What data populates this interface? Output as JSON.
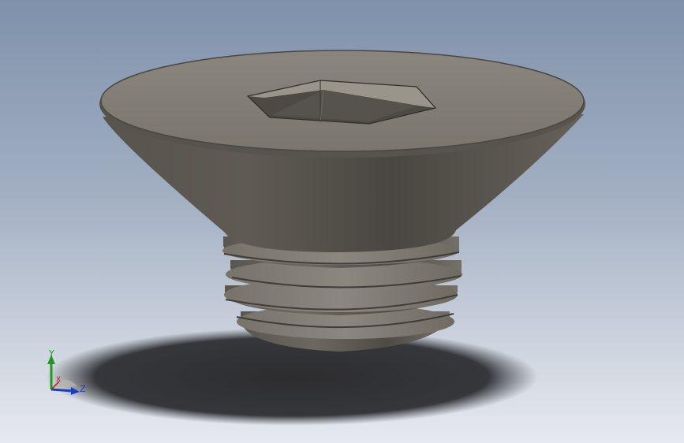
{
  "viewport": {
    "background_top": "#7f91ab",
    "background_bottom": "#e6e9ef"
  },
  "model": {
    "part_type": "countersunk socket head screw",
    "body_color": "#6e6a63",
    "shadow_color": "#3a3a3c"
  },
  "triad": {
    "y_label": "Y",
    "z_label": "Z",
    "x_label": "X",
    "y_color": "#1f9a1f",
    "z_color": "#1a3fbf",
    "x_color": "#b51d1d"
  }
}
